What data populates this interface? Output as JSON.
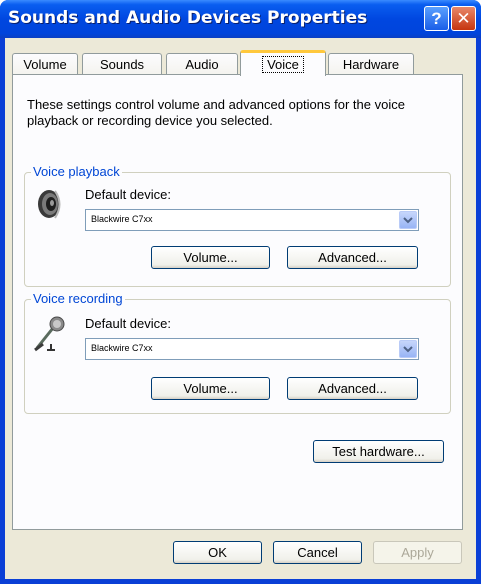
{
  "window": {
    "title": "Sounds and Audio Devices Properties",
    "help_glyph": "?",
    "close_glyph": "✕"
  },
  "tabs": [
    {
      "label": "Volume"
    },
    {
      "label": "Sounds"
    },
    {
      "label": "Audio"
    },
    {
      "label": "Voice"
    },
    {
      "label": "Hardware"
    }
  ],
  "description": "These settings control volume and advanced options for the voice playback or recording device you selected.",
  "playback": {
    "legend": "Voice playback",
    "device_label": "Default device:",
    "device_value": "Blackwire C7xx",
    "volume_button": "Volume...",
    "advanced_button": "Advanced..."
  },
  "recording": {
    "legend": "Voice recording",
    "device_label": "Default device:",
    "device_value": "Blackwire C7xx",
    "volume_button": "Volume...",
    "advanced_button": "Advanced..."
  },
  "test_button": "Test hardware...",
  "footer": {
    "ok": "OK",
    "cancel": "Cancel",
    "apply": "Apply"
  },
  "icons": {
    "playback": "speaker-icon",
    "recording": "microphone-icon",
    "dropdown": "chevron-down-icon"
  }
}
